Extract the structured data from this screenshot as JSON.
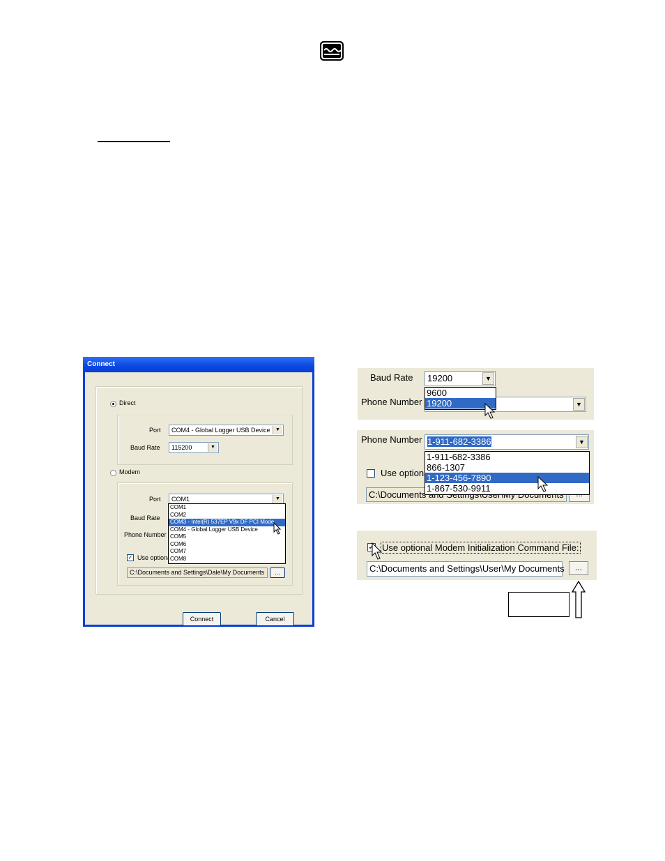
{
  "header": {
    "logo_icon": "water-wave-logo-icon"
  },
  "dialog": {
    "title": "Connect",
    "direct": {
      "radio_label": "Direct",
      "selected": true,
      "port_label": "Port",
      "port_value": "COM4 - Global Logger USB Device",
      "baud_label": "Baud Rate",
      "baud_value": "115200"
    },
    "modem": {
      "radio_label": "Modem",
      "selected": false,
      "port_label": "Port",
      "port_value": "COM1",
      "port_options": [
        "COM1",
        "COM2",
        "COM3 - Intel(R) 537EP V9x DF PCI Mode",
        "COM4 - Global Logger USB Device",
        "COM5",
        "COM6",
        "COM7",
        "COM8"
      ],
      "port_selected_index": 2,
      "baud_label": "Baud Rate",
      "phone_label": "Phone Number",
      "optional_label": "Use optional",
      "optional_checked": true,
      "path_value": "C:\\Documents and Settings\\Dale\\My Documents",
      "browse_label": "..."
    },
    "connect_button": "Connect",
    "cancel_button": "Cancel"
  },
  "panel_baud": {
    "baud_label": "Baud Rate",
    "baud_value": "19200",
    "options": [
      "9600",
      "19200"
    ],
    "selected_index": 1,
    "phone_label": "Phone Number"
  },
  "panel_phone": {
    "phone_label": "Phone Number",
    "phone_value": "1-911-682-3386",
    "options": [
      "1-911-682-3386",
      "866-1307",
      "1-123-456-7890",
      "1-867-530-9911"
    ],
    "selected_index": 2,
    "optional_label": "Use optiona",
    "path_value": "C:\\Documents and Settings\\User\\My Documents",
    "browse_label": "..."
  },
  "panel_init": {
    "optional_label": "Use optional Modem Initialization Command File:",
    "optional_checked": true,
    "path_value": "C:\\Documents and Settings\\User\\My Documents",
    "browse_label": "..."
  }
}
